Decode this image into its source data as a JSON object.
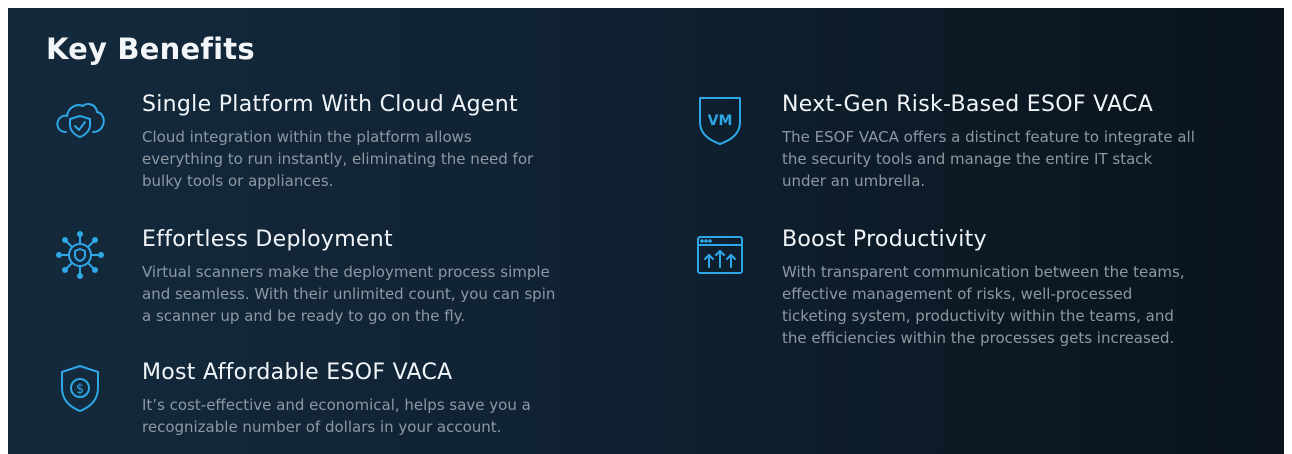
{
  "section": {
    "title": "Key Benefits"
  },
  "colors": {
    "icon_accent": "#2ea7e6",
    "heading_text": "#f2f5f8",
    "body_text": "#8d98a2",
    "background": "#102334"
  },
  "benefits": [
    {
      "icon": "cloud-shield-icon",
      "title": "Single Platform With Cloud Agent",
      "lines": [
        "Cloud integration within the platform allows",
        "everything to run instantly, eliminating the need for",
        "bulky tools or appliances."
      ]
    },
    {
      "icon": "network-shield-icon",
      "title": "Effortless Deployment",
      "lines": [
        "Virtual scanners make the deployment process simple",
        "and seamless. With their unlimited count, you can spin",
        "a scanner up and be ready to go on the fly."
      ]
    },
    {
      "icon": "dollar-shield-icon",
      "title": "Most Affordable ESOF VACA",
      "lines": [
        "It’s cost-effective and economical, helps save you a",
        "recognizable number of dollars in your account."
      ]
    },
    {
      "icon": "vm-shield-icon",
      "icon_text": "VM",
      "title": "Next-Gen Risk-Based ESOF VACA",
      "lines": [
        "The ESOF VACA offers a distinct feature to integrate all",
        "the security tools and manage the entire IT stack",
        "under an umbrella."
      ]
    },
    {
      "icon": "productivity-window-icon",
      "title": "Boost Productivity",
      "lines": [
        "With transparent communication between the teams,",
        "effective management of risks, well-processed",
        "ticketing system, productivity within the teams, and",
        "the efficiencies within the processes gets increased."
      ]
    }
  ]
}
